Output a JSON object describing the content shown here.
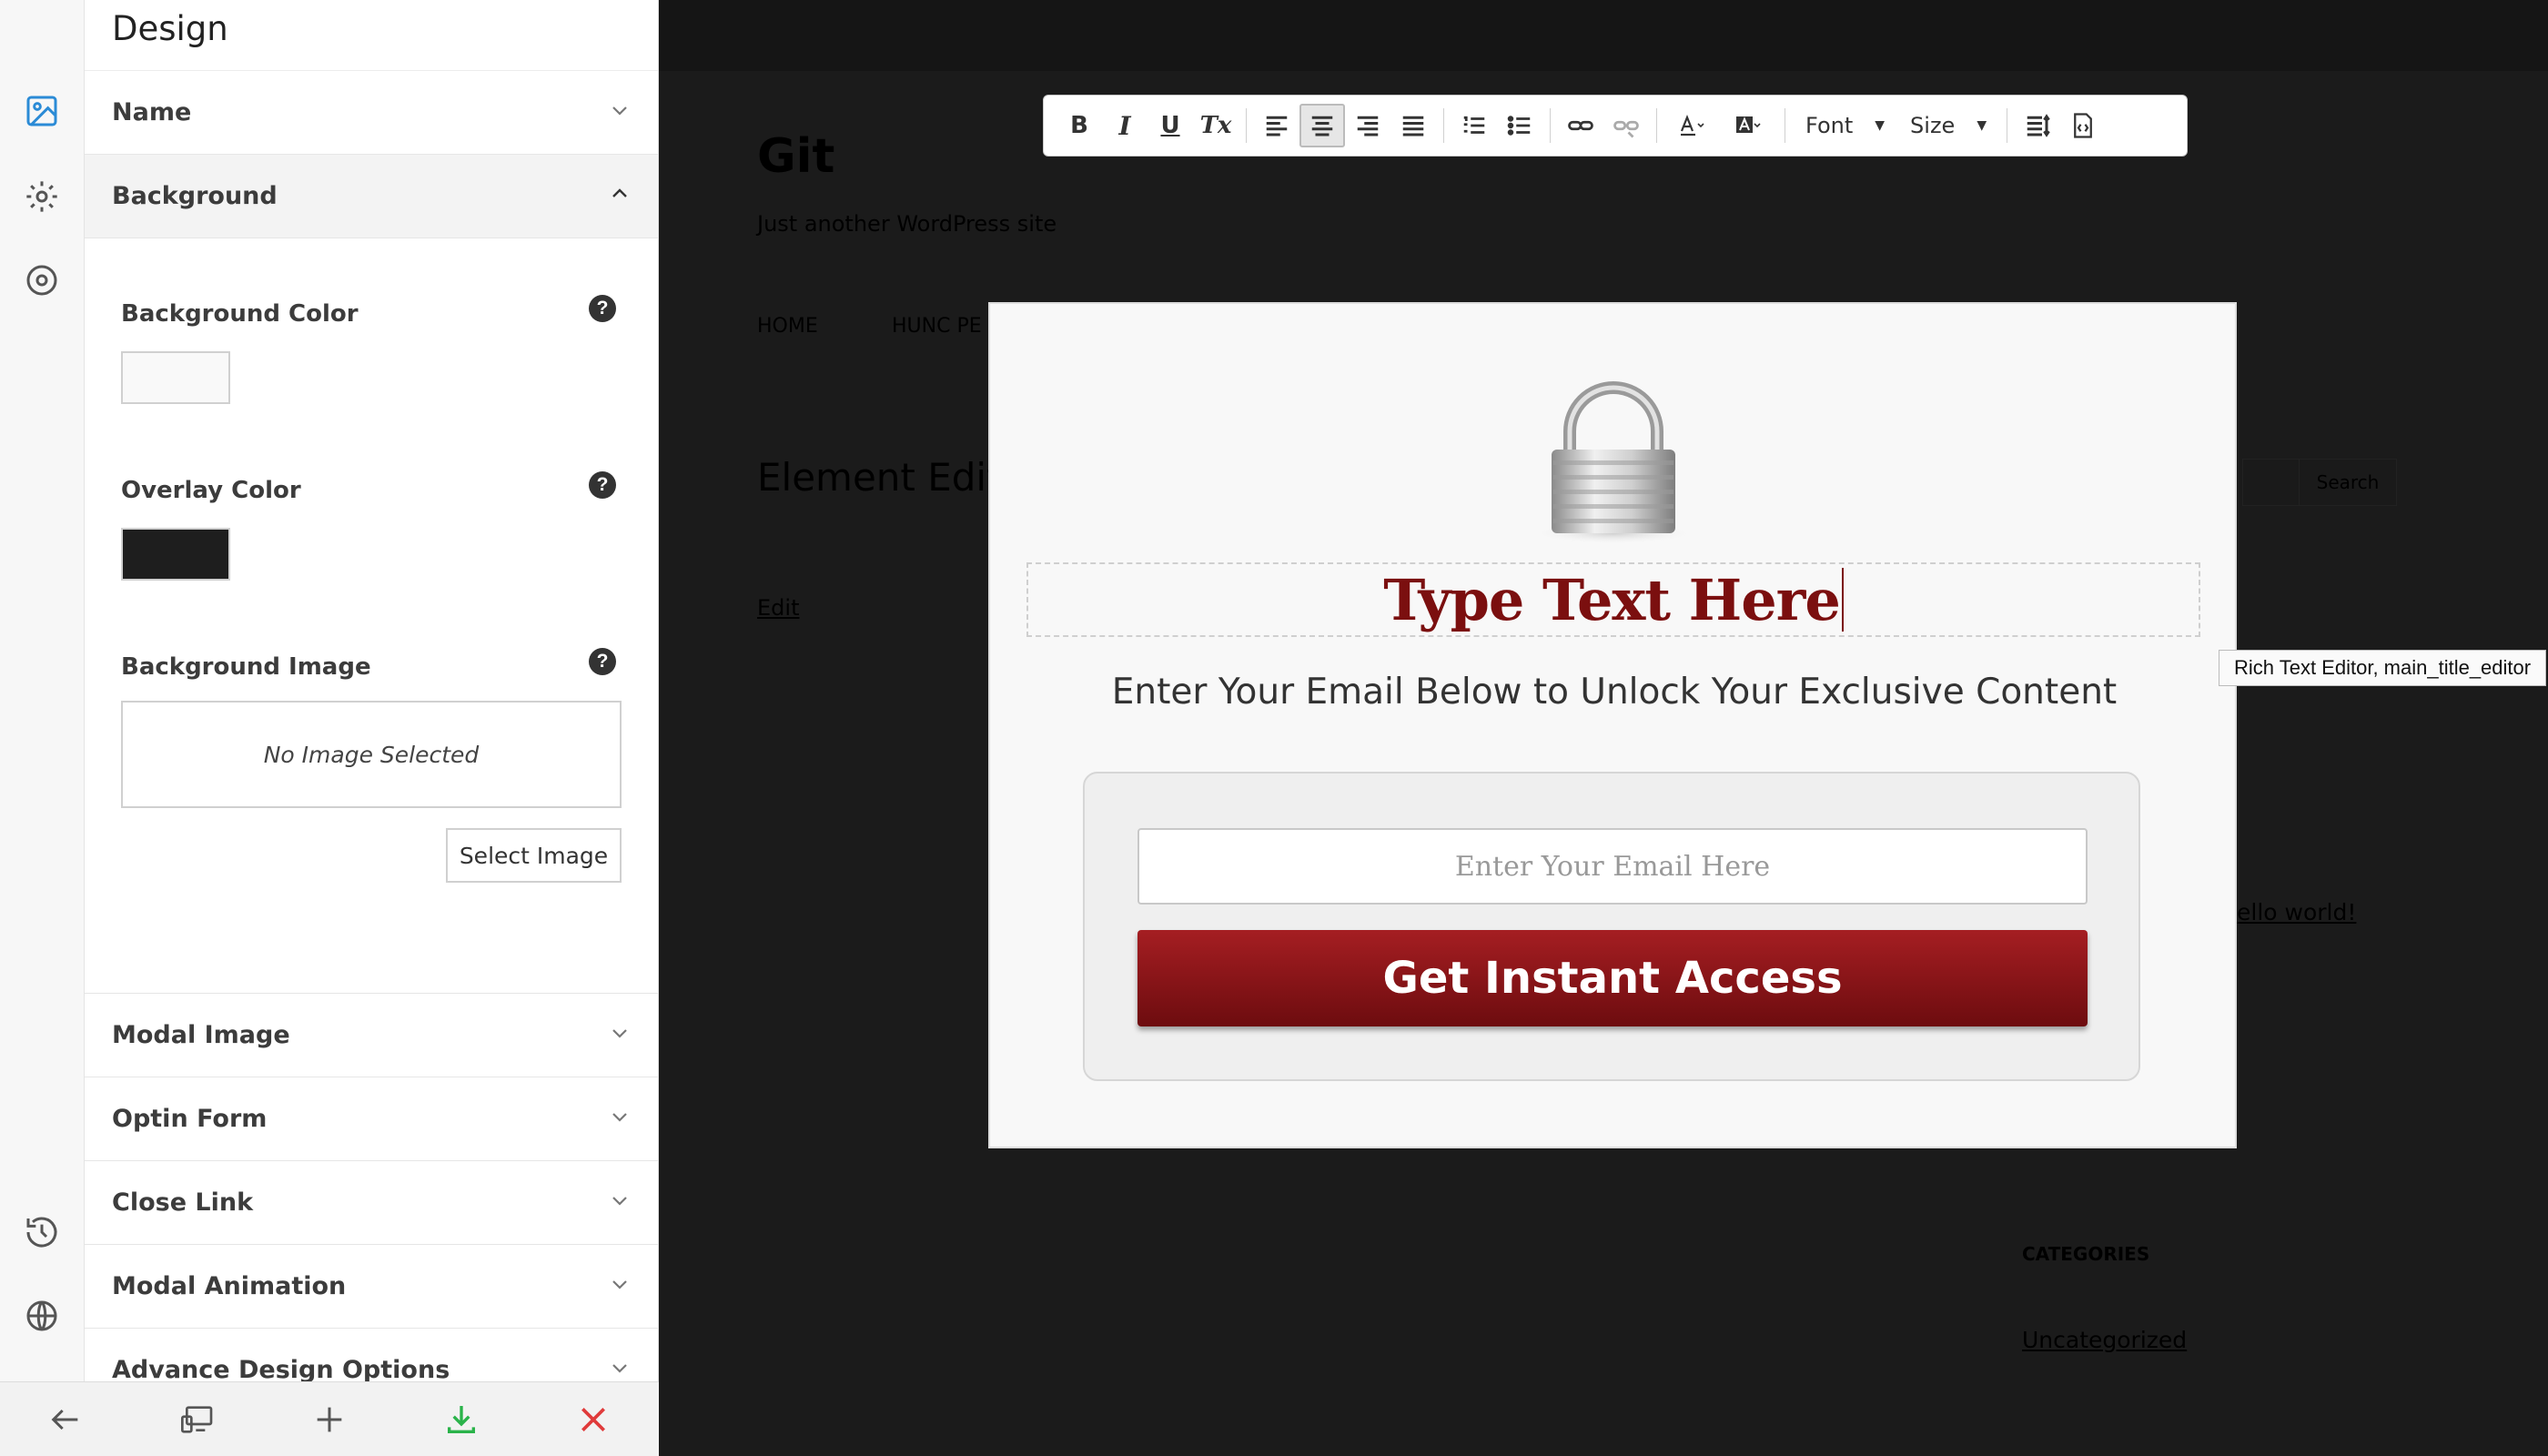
{
  "rail": {
    "icons": [
      "image-icon",
      "gear-icon",
      "target-icon",
      "history-icon",
      "globe-icon"
    ],
    "active_color": "#2b8bd6"
  },
  "panel": {
    "title": "Design",
    "sections": {
      "name": "Name",
      "background": "Background",
      "modal_image": "Modal Image",
      "optin_form": "Optin Form",
      "close_link": "Close Link",
      "modal_animation": "Modal Animation",
      "advance_design": "Advance Design Options"
    },
    "background": {
      "bg_color_label": "Background Color",
      "bg_color_value": "#f9f9f9",
      "overlay_color_label": "Overlay Color",
      "overlay_color_value": "#1e1e1e",
      "bg_image_label": "Background Image",
      "no_image_text": "No Image Selected",
      "select_image_label": "Select Image",
      "help_glyph": "?"
    }
  },
  "bottom_bar": {
    "icons": [
      "back-arrow-icon",
      "devices-icon",
      "plus-icon",
      "download-icon",
      "close-icon"
    ],
    "download_color": "#2ab34a",
    "close_color": "#e03b3b"
  },
  "site": {
    "title": "Git",
    "tagline": "Just another WordPress site",
    "nav": [
      "HOME",
      "HUNC PE"
    ],
    "page_heading": "Element Edit",
    "edit_link": "Edit",
    "search_label": "Search",
    "recent_link": "ello world!",
    "categories_heading": "CATEGORIES",
    "category_link": "Uncategorized"
  },
  "toolbar": {
    "font_label": "Font",
    "size_label": "Size",
    "bold": "B",
    "italic": "I",
    "underline": "U",
    "clear_format": "Tx"
  },
  "modal": {
    "title": "Type Text Here",
    "subtitle": "Enter Your Email Below to Unlock Your Exclusive Content",
    "email_placeholder": "Enter Your Email Here",
    "cta_label": "Get Instant Access",
    "tooltip": "Rich Text Editor, main_title_editor",
    "title_color": "#7b0f0f",
    "cta_color": "#8c1418"
  }
}
